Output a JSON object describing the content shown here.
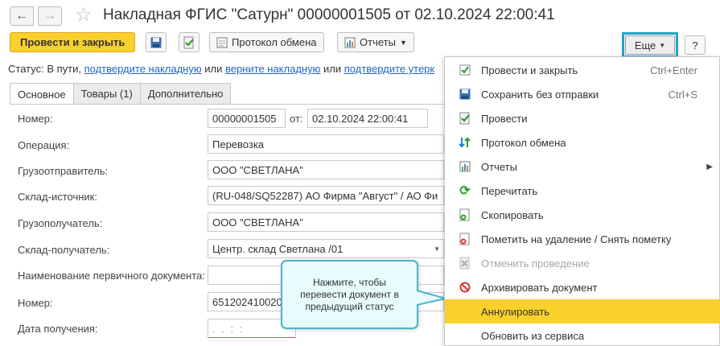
{
  "window": {
    "title": "Накладная ФГИС \"Сатурн\" 00000001505 от 02.10.2024 22:00:41"
  },
  "toolbar": {
    "post_close": "Провести и закрыть",
    "exchange_log": "Протокол обмена",
    "reports": "Отчеты",
    "more": "Еще",
    "help": "?"
  },
  "status": {
    "prefix": "Статус:  В пути, ",
    "link1": "подтвердите накладную",
    "or1": " или ",
    "link2": "верните накладную",
    "or2": " или ",
    "link3": "подтвердите утерк"
  },
  "tabs": [
    {
      "label": "Основное"
    },
    {
      "label": "Товары (1)"
    },
    {
      "label": "Дополнительно"
    }
  ],
  "form": {
    "number_label": "Номер:",
    "number_value": "00000001505",
    "from_label": "от:",
    "date_value": "02.10.2024 22:00:41",
    "operation_label": "Операция:",
    "operation_value": "Перевозка",
    "shipper_label": "Грузоотправитель:",
    "shipper_value": "ООО \"СВЕТЛАНА\"",
    "source_wh_label": "Склад-источник:",
    "source_wh_value": "(RU-048/SQ52287) АО Фирма \"Август\" / АО Фи",
    "consignee_label": "Грузополучатель:",
    "consignee_value": "ООО \"СВЕТЛАНА\"",
    "dest_wh_label": "Склад-получатель:",
    "dest_wh_value": "Центр. склад Светлана /01",
    "primary_doc_label": "Наименование первичного документа:",
    "primary_doc_value": "",
    "number2_label": "Номер:",
    "number2_value": "651202410020",
    "receive_date_label": "Дата получения:",
    "receive_date_value": " .  .     :  :"
  },
  "menu": {
    "items": [
      {
        "label": "Провести и закрыть",
        "shortcut": "Ctrl+Enter",
        "icon": "post-close-icon"
      },
      {
        "label": "Сохранить без отправки",
        "shortcut": "Ctrl+S",
        "icon": "save-icon"
      },
      {
        "label": "Провести",
        "shortcut": "",
        "icon": "post-icon"
      },
      {
        "label": "Протокол обмена",
        "shortcut": "",
        "icon": "exchange-icon"
      },
      {
        "label": "Отчеты",
        "shortcut": "",
        "icon": "reports-icon"
      },
      {
        "label": "Перечитать",
        "shortcut": "",
        "icon": "reread-icon"
      },
      {
        "label": "Скопировать",
        "shortcut": "",
        "icon": "copy-icon"
      },
      {
        "label": "Пометить на удаление / Снять пометку",
        "shortcut": "",
        "icon": "mark-delete-icon"
      },
      {
        "label": "Отменить проведение",
        "shortcut": "",
        "icon": "unpost-icon"
      },
      {
        "label": "Архивировать документ",
        "shortcut": "",
        "icon": "archive-icon"
      },
      {
        "label": "Аннулировать",
        "shortcut": "",
        "icon": "annul-icon"
      },
      {
        "label": "Обновить из сервиса",
        "shortcut": "",
        "icon": "refresh-service-icon"
      }
    ]
  },
  "callout": {
    "text": "Нажмите, чтобы перевести документ в предыдущий статус"
  },
  "colors": {
    "accent": "#fad12a",
    "link": "#2662c4",
    "highlight_frame": "#23a3c3"
  }
}
